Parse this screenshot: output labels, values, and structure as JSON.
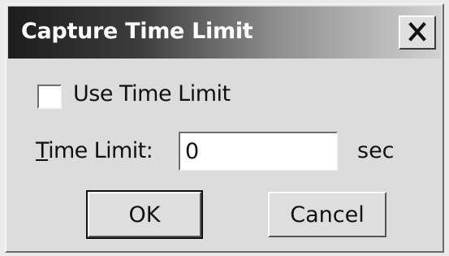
{
  "window": {
    "title": "Capture Time Limit"
  },
  "titlebar": {
    "close_icon": "close-icon"
  },
  "options": {
    "use_time_limit_label": "Use Time Limit",
    "use_time_limit_checked": false
  },
  "time_limit": {
    "label_mnemonic": "T",
    "label_rest": "ime Limit:",
    "value": "0",
    "unit": "sec"
  },
  "buttons": {
    "ok_label": "OK",
    "cancel_label": "Cancel"
  }
}
